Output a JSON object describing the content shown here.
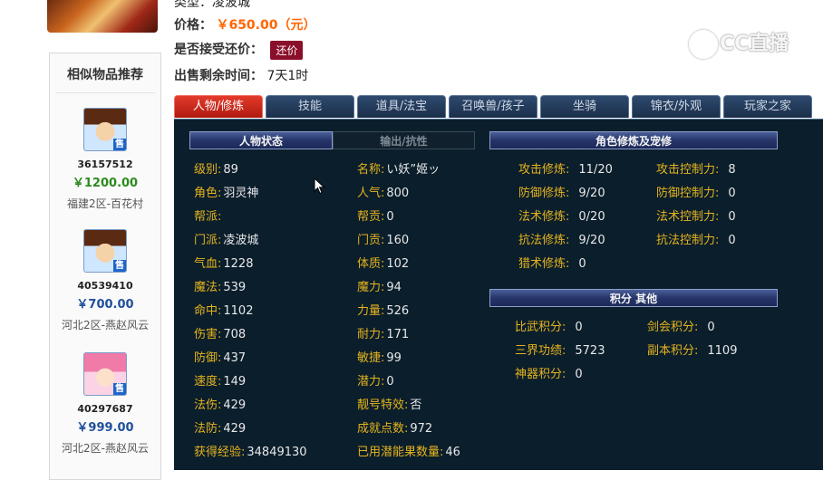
{
  "header": {
    "server_line": "类型：凌波城",
    "price_label": "价格：",
    "price_value": "￥650.00（元）",
    "bargain_label": "是否接受还价：",
    "bargain_button": "还价",
    "remaining_label": "出售剩余时间：",
    "remaining_value": "7天1时"
  },
  "watermark": {
    "text": "CC直播"
  },
  "sidebar": {
    "title": "相似物品推荐",
    "items": [
      {
        "id": "36157512",
        "price": "￥1200.00",
        "server": "福建2区-百花村",
        "badge": "售",
        "avatar": "boy"
      },
      {
        "id": "40539410",
        "price": "￥700.00",
        "server": "河北2区-燕赵风云",
        "badge": "售",
        "avatar": "boy"
      },
      {
        "id": "40297687",
        "price": "￥999.00",
        "server": "河北2区-燕赵风云",
        "badge": "售",
        "avatar": "girl"
      }
    ]
  },
  "tabs": [
    "人物/修炼",
    "技能",
    "道具/法宝",
    "召唤兽/孩子",
    "坐骑",
    "锦衣/外观",
    "玩家之家"
  ],
  "active_tab": "人物/修炼",
  "character": {
    "subtab_status": "人物状态",
    "subtab_output": "输出/抗性",
    "left_stats": [
      {
        "label": "级别:",
        "value": "89"
      },
      {
        "label": "角色:",
        "value": "羽灵神"
      },
      {
        "label": "帮派:",
        "value": ""
      },
      {
        "label": "门派:",
        "value": "凌波城"
      },
      {
        "label": "气血:",
        "value": "1228"
      },
      {
        "label": "魔法:",
        "value": "539"
      },
      {
        "label": "命中:",
        "value": "1102"
      },
      {
        "label": "伤害:",
        "value": "708"
      },
      {
        "label": "防御:",
        "value": "437"
      },
      {
        "label": "速度:",
        "value": "149"
      },
      {
        "label": "法伤:",
        "value": "429"
      },
      {
        "label": "法防:",
        "value": "429"
      },
      {
        "label": "获得经验:",
        "value": "34849130"
      }
    ],
    "right_stats": [
      {
        "label": "名称:",
        "value": "い妖”姬ッ"
      },
      {
        "label": "人气:",
        "value": "800"
      },
      {
        "label": "帮贡:",
        "value": "0"
      },
      {
        "label": "门贡:",
        "value": "160"
      },
      {
        "label": "体质:",
        "value": "102"
      },
      {
        "label": "魔力:",
        "value": "94"
      },
      {
        "label": "力量:",
        "value": "526"
      },
      {
        "label": "耐力:",
        "value": "171"
      },
      {
        "label": "敏捷:",
        "value": "99"
      },
      {
        "label": "潜力:",
        "value": "0"
      },
      {
        "label": "靓号特效:",
        "value": "否"
      },
      {
        "label": "成就点数:",
        "value": "972"
      },
      {
        "label": "已用潜能果数量:",
        "value": "46"
      }
    ]
  },
  "cultivation": {
    "title": "角色修炼及宠修",
    "left": [
      {
        "label": "攻击修炼:",
        "value": "11/20"
      },
      {
        "label": "防御修炼:",
        "value": "9/20"
      },
      {
        "label": "法术修炼:",
        "value": "0/20"
      },
      {
        "label": "抗法修炼:",
        "value": "9/20"
      },
      {
        "label": "猎术修炼:",
        "value": "0"
      }
    ],
    "right": [
      {
        "label": "攻击控制力:",
        "value": "8"
      },
      {
        "label": "防御控制力:",
        "value": "0"
      },
      {
        "label": "法术控制力:",
        "value": "0"
      },
      {
        "label": "抗法控制力:",
        "value": "0"
      }
    ]
  },
  "points": {
    "title": "积分 其他",
    "left": [
      {
        "label": "比武积分:",
        "value": "0"
      },
      {
        "label": "三界功绩:",
        "value": "5723"
      },
      {
        "label": "神器积分:",
        "value": "0"
      }
    ],
    "right": [
      {
        "label": "剑会积分:",
        "value": "0"
      },
      {
        "label": "副本积分:",
        "value": "1109"
      }
    ]
  }
}
